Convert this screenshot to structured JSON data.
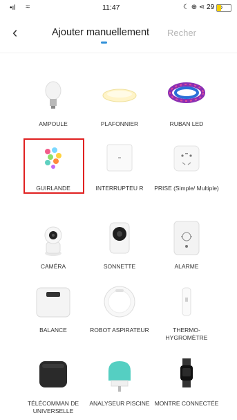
{
  "status": {
    "signal": "•ıl",
    "wifi": "≈",
    "time": "11:47",
    "right": "☾ ⊕ ⋖ 29 %"
  },
  "nav": {
    "back": "‹",
    "tab_active": "Ajouter manuellement",
    "tab_inactive": "Recher"
  },
  "items": [
    {
      "label": "AMPOULE"
    },
    {
      "label": "PLAFONNIER"
    },
    {
      "label": "RUBAN LED"
    },
    {
      "label": "GUIRLANDE"
    },
    {
      "label": "INTERRUPTEU R"
    },
    {
      "label": "PRISE (Simple/ Multiple)"
    },
    {
      "label": "CAMÉRA"
    },
    {
      "label": "SONNETTE"
    },
    {
      "label": "ALARME"
    },
    {
      "label": "BALANCE"
    },
    {
      "label": "ROBOT ASPIRATEUR"
    },
    {
      "label": "THERMO- HYGROMÈTRE"
    },
    {
      "label": "TÉLÉCOMMAN DE UNIVERSELLE"
    },
    {
      "label": "ANALYSEUR PISCINE"
    },
    {
      "label": "MONTRE CONNECTÉE"
    }
  ]
}
